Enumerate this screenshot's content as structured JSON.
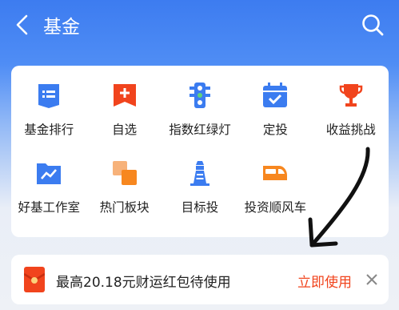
{
  "header": {
    "title": "基金",
    "back_icon": "chevron-left-icon",
    "search_icon": "search-icon"
  },
  "menu": {
    "row1": [
      {
        "label": "基金排行",
        "icon": "ranking-list-icon",
        "color": "#3b7cf0"
      },
      {
        "label": "自选",
        "icon": "add-favorite-icon",
        "color": "#f1441d"
      },
      {
        "label": "指数红绿灯",
        "icon": "traffic-light-icon",
        "color": "#3b7cf0"
      },
      {
        "label": "定投",
        "icon": "calendar-check-icon",
        "color": "#3b7cf0"
      },
      {
        "label": "收益挑战",
        "icon": "trophy-icon",
        "color": "#f1441d"
      }
    ],
    "row2": [
      {
        "label": "好基工作室",
        "icon": "trend-folder-icon",
        "color": "#3b7cf0"
      },
      {
        "label": "热门板块",
        "icon": "blocks-icon",
        "color": "#f7871f"
      },
      {
        "label": "目标投",
        "icon": "lighthouse-icon",
        "color": "#3b7cf0"
      },
      {
        "label": "投资顺风车",
        "icon": "train-icon",
        "color": "#f7871f"
      }
    ]
  },
  "promo": {
    "text": "最高20.18元财运红包待使用",
    "action": "立即使用",
    "icon": "red-envelope-icon",
    "close_icon": "close-icon",
    "accent": "#f1441d"
  },
  "colors": {
    "header": "#3d7cf0",
    "blue": "#3b7cf0",
    "orange": "#f7871f",
    "red": "#f1441d"
  }
}
